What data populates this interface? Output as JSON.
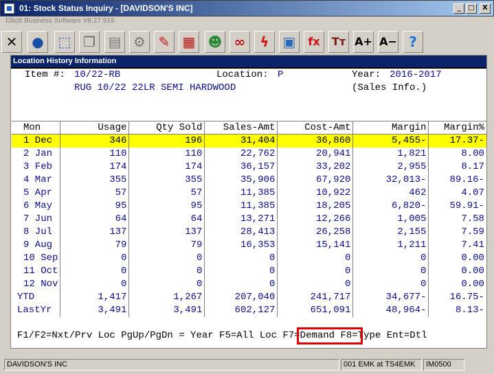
{
  "window": {
    "title": "01: Stock Status Inquiry - [DAVIDSON'S INC]",
    "subtitle": "Elliott Business Software V8.27.918",
    "min_label": "_",
    "max_label": "□",
    "close_label": "X"
  },
  "toolbar": {
    "items": [
      {
        "name": "exit-icon",
        "glyph": "✕",
        "color": "#111111"
      },
      {
        "name": "globe-icon",
        "glyph": "●",
        "color": "#1a4fa8"
      },
      {
        "name": "select-icon",
        "glyph": "⬚",
        "color": "#2b4fd0"
      },
      {
        "name": "copy-icon",
        "glyph": "❐",
        "color": "#666666"
      },
      {
        "name": "paste-icon",
        "glyph": "▤",
        "color": "#777777"
      },
      {
        "name": "settings-icon",
        "glyph": "⚙",
        "color": "#7a7a7a"
      },
      {
        "name": "edit-icon",
        "glyph": "✎",
        "color": "#c01818"
      },
      {
        "name": "report-icon",
        "glyph": "▦",
        "color": "#c01818"
      },
      {
        "name": "users-icon",
        "glyph": "☻",
        "color": "#2a8a3a"
      },
      {
        "name": "link-icon",
        "glyph": "∞",
        "color": "#c01818"
      },
      {
        "name": "lightning-icon",
        "glyph": "ϟ",
        "color": "#d01010"
      },
      {
        "name": "calendar-icon",
        "glyph": "▣",
        "color": "#2a6bb8"
      },
      {
        "name": "function-icon",
        "glyph": "fx",
        "color": "#d01010"
      },
      {
        "name": "font-icon",
        "glyph": "Tт",
        "color": "#7a1a1a"
      },
      {
        "name": "font-increase-icon",
        "glyph": "A+",
        "color": "#000000"
      },
      {
        "name": "font-decrease-icon",
        "glyph": "A−",
        "color": "#000000"
      },
      {
        "name": "help-icon",
        "glyph": "?",
        "color": "#1f6fd0"
      }
    ]
  },
  "panel": {
    "title": "Location History Information",
    "item_label": "Item #:",
    "item_value": "10/22-RB",
    "location_label": "Location:",
    "location_value": "P",
    "year_label": "Year:",
    "year_value": "2016-2017",
    "description": "RUG 10/22 22LR SEMI HARDWOOD",
    "info_type": "(Sales Info.)"
  },
  "table": {
    "columns": [
      "Mon",
      "Usage",
      "Qty Sold",
      "Sales-Amt",
      "Cost-Amt",
      "Margin",
      "Margin%"
    ],
    "rows": [
      [
        "1 Dec",
        "346",
        "196",
        "31,404",
        "36,860",
        "5,455-",
        "17.37-"
      ],
      [
        "2 Jan",
        "110",
        "110",
        "22,762",
        "20,941",
        "1,821",
        "8.00"
      ],
      [
        "3 Feb",
        "174",
        "174",
        "36,157",
        "33,202",
        "2,955",
        "8.17"
      ],
      [
        "4 Mar",
        "355",
        "355",
        "35,906",
        "67,920",
        "32,013-",
        "89.16-"
      ],
      [
        "5 Apr",
        "57",
        "57",
        "11,385",
        "10,922",
        "462",
        "4.07"
      ],
      [
        "6 May",
        "95",
        "95",
        "11,385",
        "18,205",
        "6,820-",
        "59.91-"
      ],
      [
        "7 Jun",
        "64",
        "64",
        "13,271",
        "12,266",
        "1,005",
        "7.58"
      ],
      [
        "8 Jul",
        "137",
        "137",
        "28,413",
        "26,258",
        "2,155",
        "7.59"
      ],
      [
        "9 Aug",
        "79",
        "79",
        "16,353",
        "15,141",
        "1,211",
        "7.41"
      ],
      [
        "10 Sep",
        "0",
        "0",
        "0",
        "0",
        "0",
        "0.00"
      ],
      [
        "11 Oct",
        "0",
        "0",
        "0",
        "0",
        "0",
        "0.00"
      ],
      [
        "12 Nov",
        "0",
        "0",
        "0",
        "0",
        "0",
        "0.00"
      ],
      [
        "YTD",
        "1,417",
        "1,267",
        "207,040",
        "241,717",
        "34,677-",
        "16.75-"
      ],
      [
        "LastYr",
        "3,491",
        "3,491",
        "602,127",
        "651,091",
        "48,964-",
        "8.13-"
      ]
    ],
    "selected_row": 0
  },
  "fkeys": {
    "part1": "F1/F2=Nxt/Prv Loc PgUp/PgDn = Year F5=All Loc ",
    "demand": "F7=Demand",
    "part2": " F8=Type Ent=Dtl"
  },
  "status": {
    "company": "DAVIDSON'S INC",
    "session": "001 EMK at TS4EMK",
    "program": "IM0500"
  }
}
